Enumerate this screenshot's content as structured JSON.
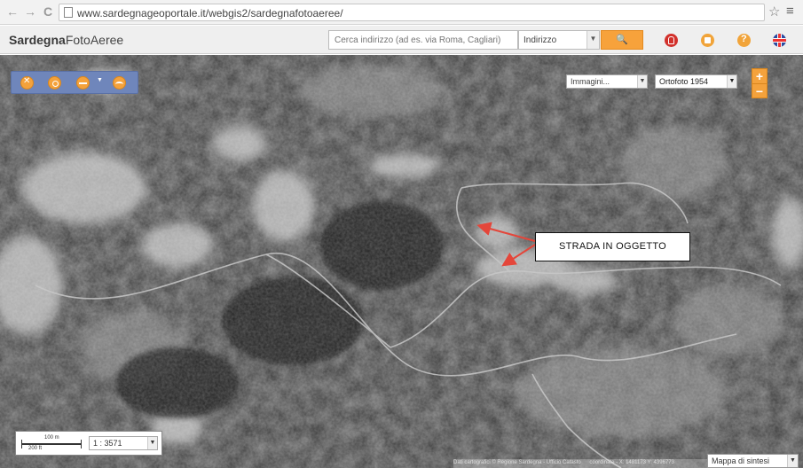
{
  "browser": {
    "back_icon": "←",
    "forward_icon": "→",
    "reload_icon": "C",
    "url": "www.sardegnageoportale.it/webgis2/sardegnafotoaeree/",
    "star_icon": "☆",
    "menu_icon": "≡"
  },
  "header": {
    "brand_bold": "Sardegna",
    "brand_light": "FotoAeree",
    "search_placeholder": "Cerca indirizzo (ad es. via Roma, Cagliari)",
    "address_type": "Indirizzo",
    "search_icon": "🔍"
  },
  "map": {
    "images_select": "Immagini...",
    "ortho_select": "Ortofoto 1954",
    "zoom_in": "+",
    "zoom_out": "−",
    "callout": "STRADA IN OGGETTO",
    "scale_top": "100 m",
    "scale_bottom": "200 ft",
    "scale_ratio": "1 : 3571",
    "attribution": "Dati cartografici © Regione Sardegna - Ufficio Catasto",
    "coordinates": "coordinate - X: 1481173 Y: 4396773",
    "overview_label": "Mappa di sintesi",
    "colors": {
      "accent_orange": "#f4a23c",
      "toolbar_blue": "#6f86bb",
      "arrow_red": "#e4463a"
    }
  }
}
